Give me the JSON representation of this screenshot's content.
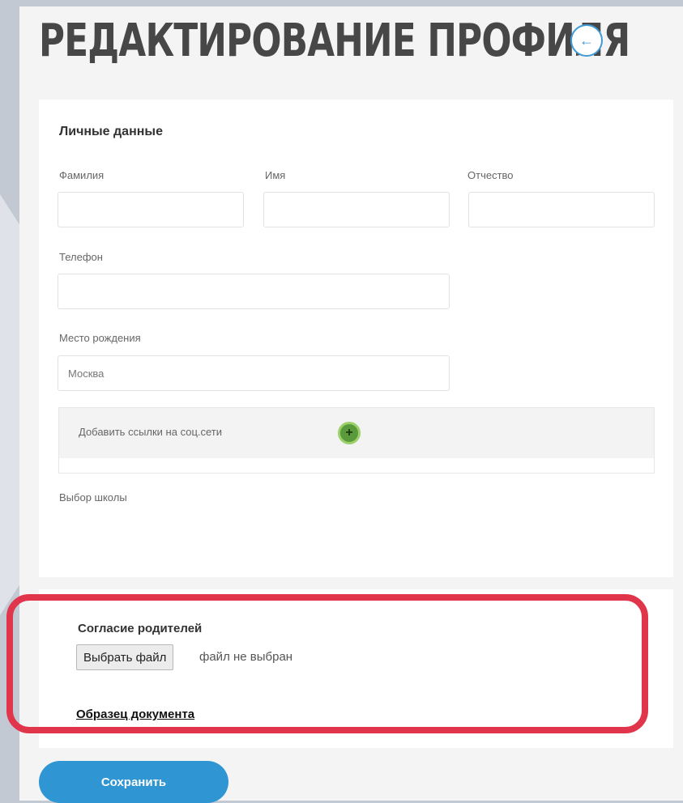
{
  "header": {
    "title": "РЕДАКТИРОВАНИЕ ПРОФИЛЯ",
    "back_icon": "arrow-left-icon"
  },
  "personal": {
    "section_title": "Личные данные",
    "last_name_label": "Фамилия",
    "first_name_label": "Имя",
    "patronymic_label": "Отчество",
    "phone_label": "Телефон",
    "birthplace_label": "Место рождения",
    "birthplace_value": "Москва",
    "social_label": "Добавить ссылки на соц.сети",
    "school_label": "Выбор школы"
  },
  "consent": {
    "title": "Согласие родителей",
    "file_button": "Выбрать файл",
    "file_status": "файл не выбран",
    "sample_link": "Образец документа"
  },
  "footer": {
    "save_label": "Сохранить"
  },
  "colors": {
    "accent": "#2f95d3",
    "highlight": "#e0354a",
    "add": "#5a9a3a"
  }
}
